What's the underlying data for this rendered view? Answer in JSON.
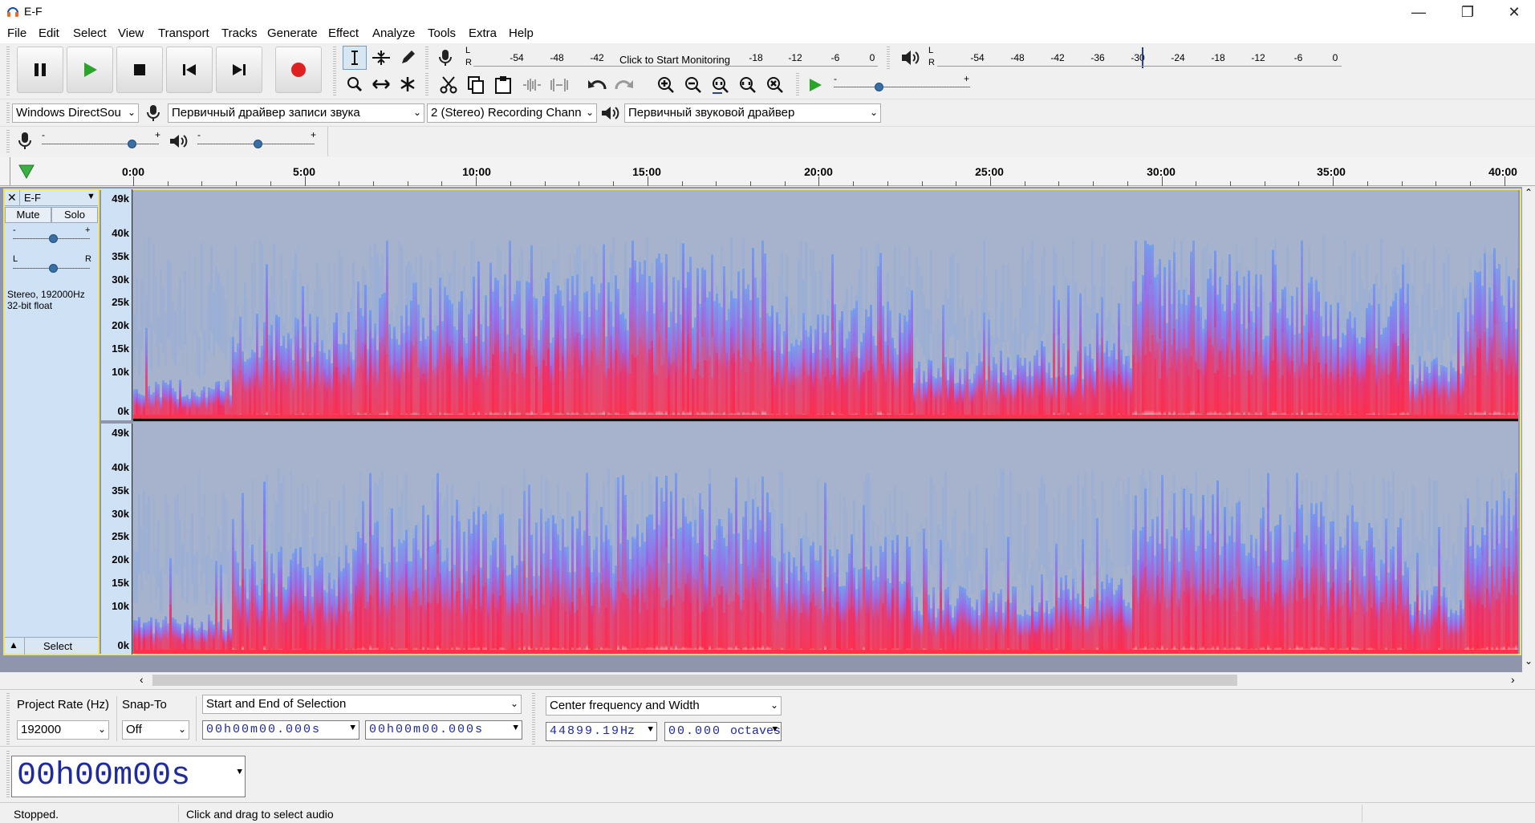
{
  "window": {
    "title": "E-F"
  },
  "menu": [
    "File",
    "Edit",
    "Select",
    "View",
    "Transport",
    "Tracks",
    "Generate",
    "Effect",
    "Analyze",
    "Tools",
    "Extra",
    "Help"
  ],
  "meters": {
    "record_ticks": [
      "-54",
      "-48",
      "-42",
      "Click to Start Monitoring",
      "-18",
      "-12",
      "-6",
      "0"
    ],
    "play_ticks": [
      "-54",
      "-48",
      "-42",
      "-36",
      "-30",
      "-24",
      "-18",
      "-12",
      "-6",
      "0"
    ],
    "l": "L",
    "r": "R"
  },
  "devices": {
    "host": "Windows DirectSou",
    "recording_device": "Первичный драйвер записи звука",
    "channels": "2 (Stereo) Recording Chann",
    "playback_device": "Первичный звуковой драйвер"
  },
  "timeline": {
    "labels": [
      "0:00",
      "5:00",
      "10:00",
      "15:00",
      "20:00",
      "25:00",
      "30:00",
      "35:00",
      "40:00"
    ]
  },
  "track": {
    "name": "E-F",
    "mute": "Mute",
    "solo": "Solo",
    "gain_minus": "-",
    "gain_plus": "+",
    "pan_l": "L",
    "pan_r": "R",
    "info_line1": "Stereo, 192000Hz",
    "info_line2": "32-bit float",
    "select": "Select",
    "freq_labels": [
      "49k",
      "40k",
      "35k",
      "30k",
      "25k",
      "20k",
      "15k",
      "10k",
      "0k"
    ]
  },
  "selection_bar": {
    "project_rate_label": "Project Rate (Hz)",
    "snap_to_label": "Snap-To",
    "selection_mode": "Start and End of Selection",
    "spectral_mode": "Center frequency and Width",
    "project_rate": "192000",
    "snap_to": "Off",
    "start_time": "00h00m00.000s",
    "end_time": "00h00m00.000s",
    "center_freq": "44899.19",
    "center_freq_unit": "Hz",
    "width": "00.000",
    "width_unit": "octaves"
  },
  "audio_position": {
    "hh": "00",
    "h": "h",
    "mm": "00",
    "m": "m",
    "ss": "00",
    "s": "s"
  },
  "status": {
    "state": "Stopped.",
    "hint": "Click and drag to select audio"
  },
  "colors": {
    "accent": "#3a6ea5",
    "record_red": "#e02020",
    "play_green": "#2aa52a",
    "spectro_red": "#ee2a55",
    "spectro_blue": "#6d9cf0"
  }
}
